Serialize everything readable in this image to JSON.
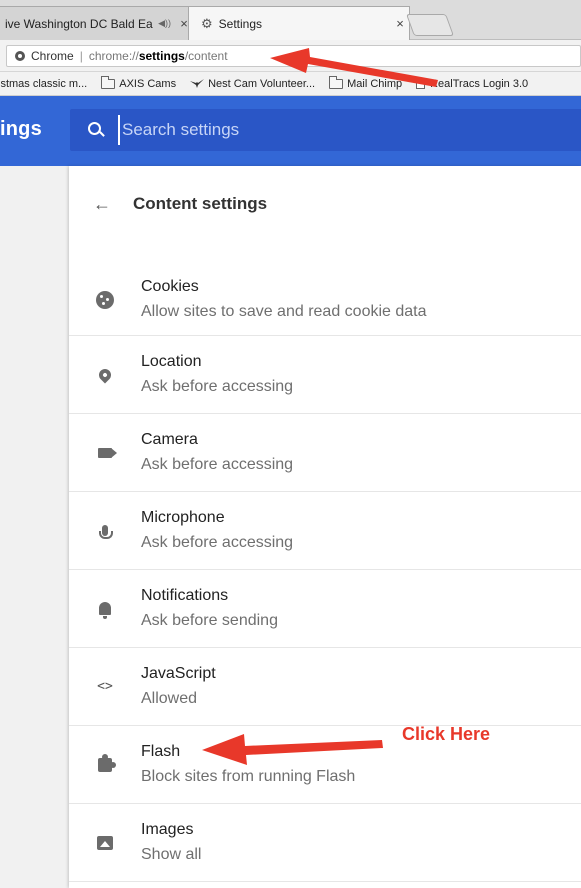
{
  "tabs": [
    {
      "title": "ive Washington DC Bald Ea",
      "audio": "◀))",
      "close": "×"
    },
    {
      "title": "Settings",
      "close": "×"
    }
  ],
  "omnibox": {
    "chip": "Chrome",
    "separator": "|",
    "url_scheme": "chrome://",
    "url_host": "settings",
    "url_path": "/content"
  },
  "bookmarks": [
    {
      "label": "istmas classic m...",
      "icon": "none"
    },
    {
      "label": "AXIS Cams",
      "icon": "folder-icon"
    },
    {
      "label": "Nest Cam Volunteer...",
      "icon": "bird-icon"
    },
    {
      "label": "Mail Chimp",
      "icon": "folder-icon"
    },
    {
      "label": "RealTracs Login 3.0",
      "icon": "page-icon"
    }
  ],
  "header": {
    "title": "ings",
    "search_placeholder": "Search settings"
  },
  "page": {
    "back_arrow": "←",
    "title": "Content settings"
  },
  "items": [
    {
      "label": "Cookies",
      "sub": "Allow sites to save and read cookie data",
      "icon": "cookie-icon"
    },
    {
      "label": "Location",
      "sub": "Ask before accessing",
      "icon": "location-pin-icon"
    },
    {
      "label": "Camera",
      "sub": "Ask before accessing",
      "icon": "camera-icon"
    },
    {
      "label": "Microphone",
      "sub": "Ask before accessing",
      "icon": "microphone-icon"
    },
    {
      "label": "Notifications",
      "sub": "Ask before sending",
      "icon": "bell-icon"
    },
    {
      "label": "JavaScript",
      "sub": "Allowed",
      "icon": "code-icon",
      "glyph": "<>"
    },
    {
      "label": "Flash",
      "sub": "Block sites from running Flash",
      "icon": "puzzle-icon"
    },
    {
      "label": "Images",
      "sub": "Show all",
      "icon": "image-icon"
    }
  ],
  "annotation": {
    "text": "Click Here",
    "color": "#e8382a"
  },
  "colors": {
    "header_blue": "#3367d6",
    "search_blue": "#2a56c6"
  }
}
